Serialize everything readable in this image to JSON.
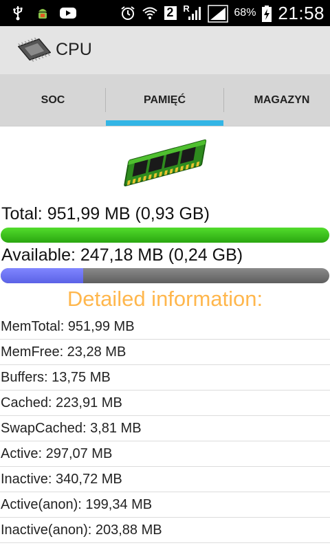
{
  "status_bar": {
    "battery_percent": "68%",
    "time": "21:58",
    "sim_label": "2",
    "roaming_label": "R",
    "icons": [
      "usb-icon",
      "android-debug-icon",
      "youtube-icon",
      "alarm-icon",
      "wifi-icon",
      "sim-icon",
      "signal-icon",
      "signal-icon",
      "battery-charging-icon"
    ]
  },
  "app_bar": {
    "title": "CPU",
    "icon": "cpu-chip-icon"
  },
  "tabs": [
    {
      "label": "SOC",
      "selected": false
    },
    {
      "label": "PAMIĘĆ",
      "selected": true
    },
    {
      "label": "MAGAZYN",
      "selected": false
    }
  ],
  "memory": {
    "image": "ram-module-icon",
    "total_text": "Total: 951,99 MB (0,93 GB)",
    "total_bar_fraction": 1.0,
    "total_bar_color": "#3ac41a",
    "available_text": "Available: 247,18 MB (0,24 GB)",
    "available_bar_fraction": 0.25,
    "available_bar_color": "#6a70f0",
    "available_track_color": "#707070"
  },
  "details": {
    "heading": "Detailed information:",
    "heading_color": "#ffb74d",
    "items": [
      "MemTotal: 951,99 MB",
      "MemFree: 23,28 MB",
      "Buffers: 13,75 MB",
      "Cached: 223,91 MB",
      "SwapCached: 3,81 MB",
      "Active: 297,07 MB",
      "Inactive: 340,72 MB",
      "Active(anon): 199,34 MB",
      "Inactive(anon): 203,88 MB"
    ]
  },
  "colors": {
    "status_bar_bg": "#000000",
    "action_bar_bg": "#e4e4e4",
    "tab_bar_bg": "#d6d6d6",
    "tab_indicator": "#33b5e5"
  }
}
